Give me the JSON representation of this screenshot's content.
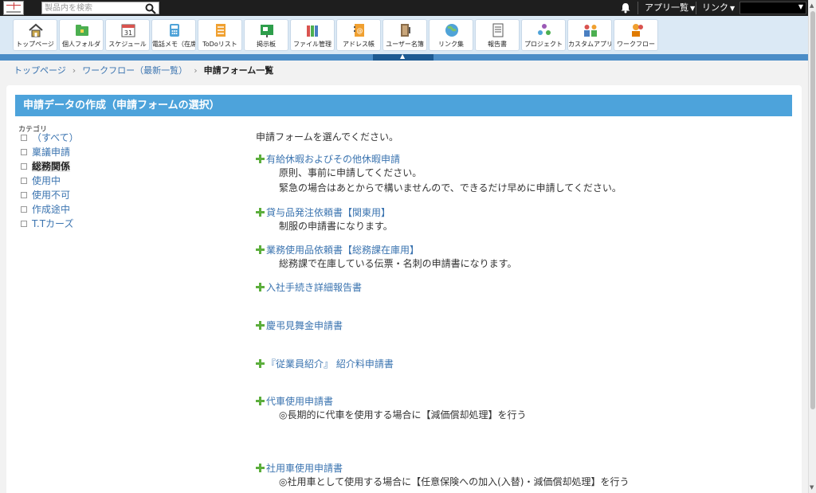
{
  "topbar": {
    "search_placeholder": "製品内を検索",
    "apps_menu": "アプリ一覧",
    "links_menu": "リンク"
  },
  "apps": [
    {
      "label": "トップページ",
      "icon": "home-icon"
    },
    {
      "label": "個人フォルダ",
      "icon": "personal-folder-icon"
    },
    {
      "label": "スケジュール",
      "icon": "calendar-icon"
    },
    {
      "label": "電話メモ（在席",
      "icon": "phone-memo-icon"
    },
    {
      "label": "ToDoリスト",
      "icon": "todo-icon"
    },
    {
      "label": "掲示板",
      "icon": "bulletin-icon"
    },
    {
      "label": "ファイル管理",
      "icon": "file-management-icon"
    },
    {
      "label": "アドレス帳",
      "icon": "address-book-icon"
    },
    {
      "label": "ユーザー名簿",
      "icon": "user-directory-icon"
    },
    {
      "label": "リンク集",
      "icon": "links-icon"
    },
    {
      "label": "報告書",
      "icon": "report-icon"
    },
    {
      "label": "プロジェクト",
      "icon": "project-icon"
    },
    {
      "label": "カスタムアプリ",
      "icon": "custom-app-icon"
    },
    {
      "label": "ワークフロー",
      "icon": "workflow-icon"
    }
  ],
  "breadcrumb": {
    "top": "トップページ",
    "workflow": "ワークフロー（最新一覧）",
    "current": "申請フォーム一覧"
  },
  "panel": {
    "title": "申請データの作成（申請フォームの選択）"
  },
  "sidebar": {
    "heading": "カテゴリ",
    "items": [
      {
        "label": "（すべて）"
      },
      {
        "label": "稟議申請"
      },
      {
        "label": "総務関係",
        "active": true
      },
      {
        "label": "使用中"
      },
      {
        "label": "使用不可"
      },
      {
        "label": "作成途中"
      },
      {
        "label": "T.Tカーズ"
      }
    ]
  },
  "main": {
    "intro": "申請フォームを選んでください。",
    "forms": [
      {
        "title": "有給休暇およびその他休暇申請",
        "desc": [
          "原則、事前に申請してください。",
          "緊急の場合はあとからで構いませんので、できるだけ早めに申請してください。"
        ]
      },
      {
        "title": "貸与品発注依頼書【関東用】",
        "desc": [
          "制服の申請書になります。"
        ]
      },
      {
        "title": "業務使用品依頼書【総務課在庫用】",
        "desc": [
          "総務課で在庫している伝票・名刺の申請書になります。"
        ]
      },
      {
        "title": "入社手続き詳細報告書",
        "desc": []
      },
      {
        "title": "慶弔見舞金申請書",
        "desc": []
      },
      {
        "title": "『従業員紹介』 紹介料申請書",
        "desc": []
      },
      {
        "title": "代車使用申請書",
        "desc": [
          "◎長期的に代車を使用する場合に【減価償却処理】を行う"
        ]
      },
      {
        "title": "社用車使用申請書",
        "desc": [
          "◎社用車として使用する場合に【任意保険への加入(入替)・減価償却処理】を行う"
        ]
      }
    ]
  }
}
